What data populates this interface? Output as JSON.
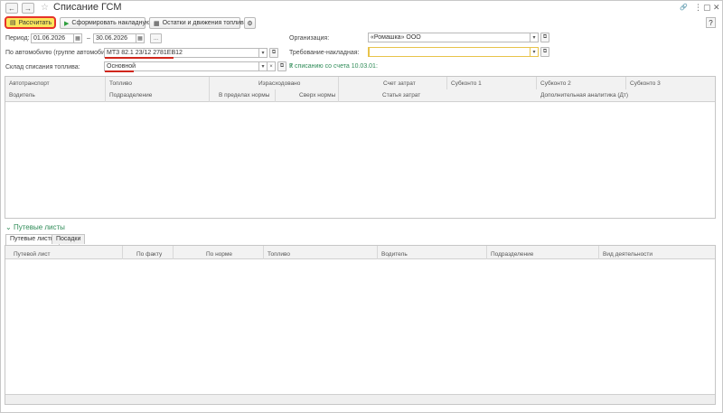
{
  "window": {
    "title": "Списание ГСМ",
    "back_icon": "←",
    "forward_icon": "→",
    "star_icon": "☆",
    "link_icon": "🔗",
    "menu_icon": "⋮",
    "maximize_icon": "▢",
    "close_icon": "✕"
  },
  "toolbar": {
    "calculate_label": "Рассчитать",
    "make_invoice_label": "Сформировать накладную",
    "balances_label": "Остатки и движения топлива",
    "help_label": "?"
  },
  "form": {
    "period_label": "Период:",
    "period_from": "01.06.2026",
    "period_dash": "–",
    "period_to": "30.06.2026",
    "period_more": "...",
    "vehicle_label": "По автомобилю (группе автомобилей):",
    "vehicle_value": "МТЗ 82.1 23/12 2781ЕВ12",
    "warehouse_label": "Склад списания топлива:",
    "warehouse_value": "Основной",
    "organization_label": "Организация:",
    "organization_value": "«Ромашка» ООО",
    "requisition_label": "Требование-накладная:",
    "requisition_value": "",
    "writeoff_note": "К списанию со счета 10.03.01:",
    "question": "?"
  },
  "fuel_table": {
    "headers_top": [
      "Автотранспорт",
      "Топливо",
      "Израсходовано",
      "Счет затрат",
      "Субконто 1",
      "Субконто 2",
      "Субконто 3"
    ],
    "headers_bottom": [
      "Водитель",
      "Подразделение",
      "В пределах нормы",
      "Сверх нормы",
      "Статья затрат",
      "Дополнительная аналитика (Дт)"
    ]
  },
  "waybills": {
    "section_title": "Путевые листы",
    "tabs": [
      "Путевые листы",
      "Посадки"
    ],
    "headers": [
      "Путевой лист",
      "По факту",
      "По норме",
      "Топливо",
      "Водитель",
      "Подразделение",
      "Вид деятельности"
    ]
  },
  "colors": {
    "accent_yellow": "#fbe75c",
    "highlight_red": "#e6332a",
    "link_green": "#2e8b57"
  }
}
